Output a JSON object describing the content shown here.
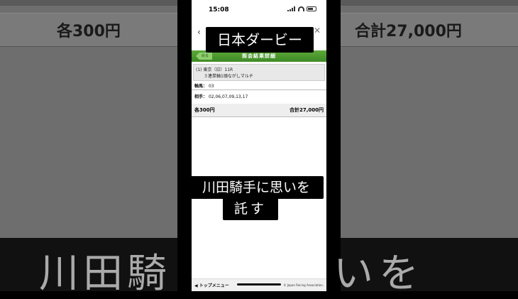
{
  "status": {
    "time": "15:08"
  },
  "header": {
    "back_label": "戻る",
    "title": "照会結果詳細"
  },
  "race": {
    "line1": "(1) 東京（日）11R",
    "line2": "３連単軸1頭ながしマルチ"
  },
  "rows": {
    "axis_label": "軸馬：",
    "axis_value": "03",
    "partner_label": "相手：",
    "partner_value": "02,06,07,09,13,17"
  },
  "totals": {
    "each": "各300円",
    "sum": "合計27,000円"
  },
  "footer": {
    "menu": "◀ トップメニュー",
    "copyright": "© Japan Racing Association."
  },
  "captions": {
    "top": "日本ダービー",
    "mid1": "川田騎手に思いを",
    "mid2": "託す"
  },
  "background": {
    "left_text": "各300円",
    "right_text": "合計27,000円",
    "caption_left": "川田騎",
    "caption_right": "いを"
  }
}
